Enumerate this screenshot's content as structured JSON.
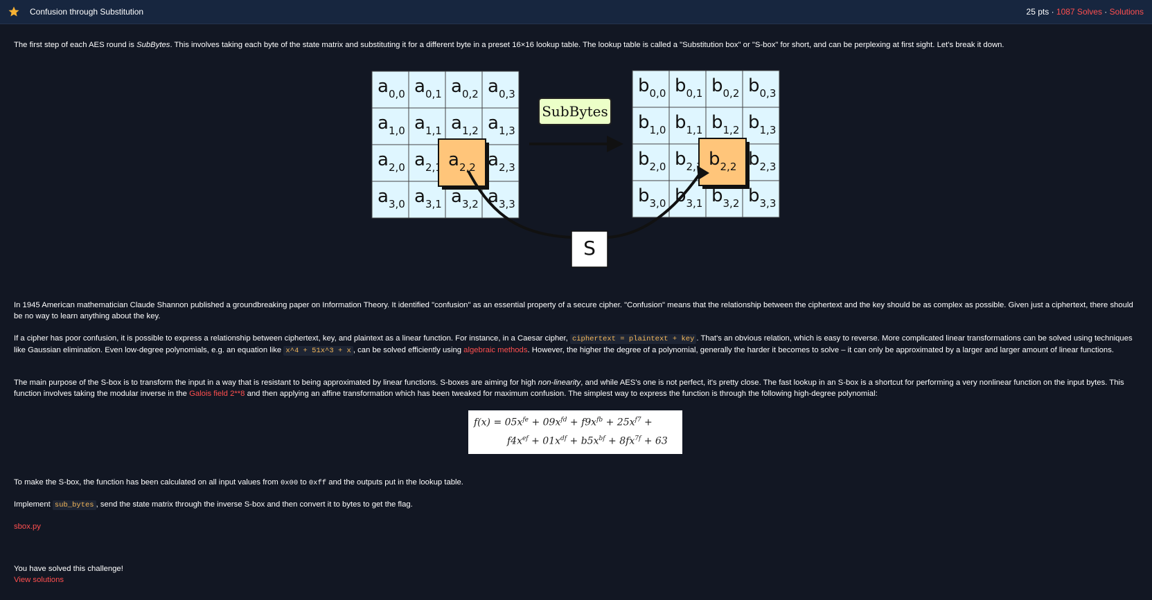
{
  "header": {
    "title": "Confusion through Substitution",
    "points": "25 pts",
    "sep1": " · ",
    "solves": "1087 Solves",
    "sep2": " · ",
    "solutions": "Solutions"
  },
  "intro": {
    "before": "The first step of each AES round is ",
    "em": "SubBytes",
    "after": ". This involves taking each byte of the state matrix and substituting it for a different byte in a preset 16×16 lookup table. The lookup table is called a \"Substitution box\" or \"S-box\" for short, and can be perplexing at first sight. Let's break it down."
  },
  "diagram": {
    "operation_label": "SubBytes",
    "sbox_label": "S",
    "left_letter": "a",
    "right_letter": "b",
    "indices": [
      [
        "0,0",
        "0,1",
        "0,2",
        "0,3"
      ],
      [
        "1,0",
        "1,1",
        "1,2",
        "1,3"
      ],
      [
        "2,0",
        "2,1",
        "2,2",
        "2,3"
      ],
      [
        "3,0",
        "3,1",
        "3,2",
        "3,3"
      ]
    ],
    "colors": {
      "cell": "#dff6ff",
      "highlight": "#ffc57a",
      "label_bg": "#ecffc8"
    }
  },
  "para1": "In 1945 American mathematician Claude Shannon published a groundbreaking paper on Information Theory. It identified \"confusion\" as an essential property of a secure cipher. \"Confusion\" means that the relationship between the ciphertext and the key should be as complex as possible. Given just a ciphertext, there should be no way to learn anything about the key.",
  "para2": {
    "t1": "If a cipher has poor confusion, it is possible to express a relationship between ciphertext, key, and plaintext as a linear function. For instance, in a Caesar cipher, ",
    "code1": "ciphertext = plaintext + key",
    "t2": ". That's an obvious relation, which is easy to reverse. More complicated linear transformations can be solved using techniques like Gaussian elimination. Even low-degree polynomials, e.g. an equation like ",
    "code2": "x^4 + 51x^3 + x",
    "t3": ", can be solved efficiently using ",
    "link": "algebraic methods",
    "t4": ". However, the higher the degree of a polynomial, generally the harder it becomes to solve – it can only be approximated by a larger and larger amount of linear functions."
  },
  "para3": {
    "t1": "The main purpose of the S-box is to transform the input in a way that is resistant to being approximated by linear functions. S-boxes are aiming for high ",
    "em": "non-linearity",
    "t2": ", and while AES's one is not perfect, it's pretty close. The fast lookup in an S-box is a shortcut for performing a very nonlinear function on the input bytes. This function involves taking the modular inverse in the ",
    "link": "Galois field 2**8",
    "t3": " and then applying an affine transformation which has been tweaked for maximum confusion. The simplest way to express the function is through the following high-degree polynomial:"
  },
  "formula": {
    "line1": "f(x) = 05x^fe + 09x^fd + f9x^fb + 25x^f7 +",
    "line2": "f4x^ef + 01x^df + b5x^bf + 8fx^7f + 63"
  },
  "para4": {
    "t1": "To make the S-box, the function has been calculated on all input values from ",
    "code1": "0x00",
    "t2": " to ",
    "code2": "0xff",
    "t3": " and the outputs put in the lookup table."
  },
  "para5": {
    "t1": "Implement ",
    "code": "sub_bytes",
    "t2": ", send the state matrix through the inverse S-box and then convert it to bytes to get the flag."
  },
  "file_link": "sbox.py",
  "solved_text": "You have solved this challenge!",
  "view_solutions": "View solutions"
}
